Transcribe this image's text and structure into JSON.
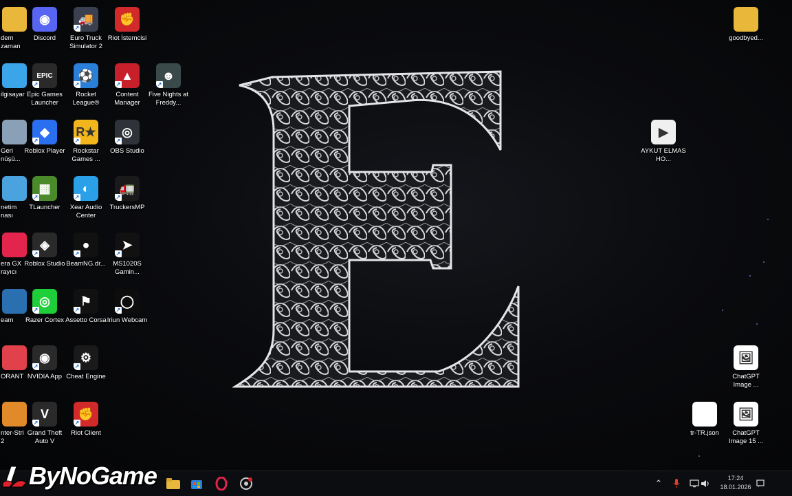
{
  "desktop": {
    "left_column_cut": [
      {
        "label": "dem\nzaman",
        "icon": "folder-icon",
        "color": "#e9b73a"
      },
      {
        "label": "ilgisayar",
        "icon": "computer-icon",
        "color": "#3aa5e8"
      },
      {
        "label": "Geri\nnüşü...",
        "icon": "recycle-bin-icon",
        "color": "#8aa0b6"
      },
      {
        "label": "netim\nnası",
        "icon": "control-panel-icon",
        "color": "#4aa3df"
      },
      {
        "label": "era GX\nrayıcı",
        "icon": "opera-gx-icon",
        "color": "#e3244c"
      },
      {
        "label": "eam",
        "icon": "steam-icon",
        "color": "#2a6fb0"
      },
      {
        "label": "ORANT",
        "icon": "valorant-icon",
        "color": "#e0414b"
      },
      {
        "label": "nter-Stri\n2",
        "icon": "counter-strike-icon",
        "color": "#e08a2a"
      }
    ],
    "icons": [
      {
        "label": "Discord",
        "icon": "discord-icon",
        "color": "#5865f2",
        "glyph": "◉"
      },
      {
        "label": "Euro Truck Simulator 2",
        "icon": "euro-truck-icon",
        "color": "#3a4050",
        "glyph": "🚚"
      },
      {
        "label": "Riot İstemcisi",
        "icon": "riot-client-icon",
        "color": "#d22a2a",
        "glyph": "✊"
      },
      {
        "label": "Epic Games Launcher",
        "icon": "epic-games-icon",
        "color": "#2a2a2a",
        "glyph": "EPIC"
      },
      {
        "label": "Rocket League®",
        "icon": "rocket-league-icon",
        "color": "#2a7fd8",
        "glyph": "⚽"
      },
      {
        "label": "Content Manager",
        "icon": "content-manager-icon",
        "color": "#c8202a",
        "glyph": "▲"
      },
      {
        "label": "Five Nights at Freddy...",
        "icon": "fnaf-icon",
        "color": "#3a4a4a",
        "glyph": "☻"
      },
      {
        "label": "Roblox Player",
        "icon": "roblox-player-icon",
        "color": "#2a6ff0",
        "glyph": "◆"
      },
      {
        "label": "Rockstar Games ...",
        "icon": "rockstar-icon",
        "color": "#f2b51c",
        "glyph": "R★"
      },
      {
        "label": "OBS Studio",
        "icon": "obs-icon",
        "color": "#30323a",
        "glyph": "◎"
      },
      {
        "label": "TLauncher",
        "icon": "tlauncher-icon",
        "color": "#4a8a2a",
        "glyph": "▦"
      },
      {
        "label": "Xear Audio Center",
        "icon": "xear-audio-icon",
        "color": "#2aa0e8",
        "glyph": "◐"
      },
      {
        "label": "TruckersMP",
        "icon": "truckersmp-icon",
        "color": "#1a1a1a",
        "glyph": "🚛"
      },
      {
        "label": "Roblox Studio",
        "icon": "roblox-studio-icon",
        "color": "#2a2a2a",
        "glyph": "◈"
      },
      {
        "label": "BeamNG.dr...",
        "icon": "beamng-icon",
        "color": "#111111",
        "glyph": "●"
      },
      {
        "label": "MS1020S Gamin...",
        "icon": "ms1020s-icon",
        "color": "#111111",
        "glyph": "➤"
      },
      {
        "label": "Razer Cortex",
        "icon": "razer-cortex-icon",
        "color": "#1fcf3a",
        "glyph": "◎"
      },
      {
        "label": "Assetto Corsa",
        "icon": "assetto-corsa-icon",
        "color": "#111111",
        "glyph": "⚑"
      },
      {
        "label": "Iriun Webcam",
        "icon": "iriun-webcam-icon",
        "color": "#0d0d0d",
        "glyph": "◯"
      },
      {
        "label": "NVIDIA App",
        "icon": "nvidia-icon",
        "color": "#2a2a2a",
        "glyph": "◉"
      },
      {
        "label": "Cheat Engine",
        "icon": "cheat-engine-icon",
        "color": "#1a1a1a",
        "glyph": "⚙"
      },
      {
        "label": "Grand Theft Auto V",
        "icon": "gta-v-icon",
        "color": "#2a2a2a",
        "glyph": "V"
      },
      {
        "label": "Riot Client",
        "icon": "riot-client-2-icon",
        "color": "#d22a2a",
        "glyph": "✊"
      }
    ],
    "right_icons": [
      {
        "label": "goodbyed...",
        "icon": "folder-icon",
        "color": "#e9b73a",
        "glyph": ""
      },
      {
        "label": "AYKUT ELMAS HO...",
        "icon": "video-file-icon",
        "color": "#f0f0f0",
        "glyph": "▶"
      },
      {
        "label": "ChatGPT Image ...",
        "icon": "image-file-icon",
        "color": "#ffffff",
        "glyph": "🖼"
      },
      {
        "label": "tr-TR.json",
        "icon": "json-file-icon",
        "color": "#ffffff",
        "glyph": ""
      },
      {
        "label": "ChatGPT Image 15 ...",
        "icon": "image-file-icon",
        "color": "#ffffff",
        "glyph": "🖼"
      }
    ]
  },
  "taskbar": {
    "clock_time": "17:24",
    "clock_date": "18.01.2026",
    "apps": [
      {
        "name": "file-explorer-taskbar-icon",
        "glyph": "📁"
      },
      {
        "name": "microsoft-store-taskbar-icon",
        "glyph": "▦"
      },
      {
        "name": "opera-gx-taskbar-icon",
        "glyph": "◯"
      },
      {
        "name": "steam-like-taskbar-icon",
        "glyph": "⚙"
      }
    ]
  },
  "watermark": {
    "text": "ByNoGame"
  }
}
